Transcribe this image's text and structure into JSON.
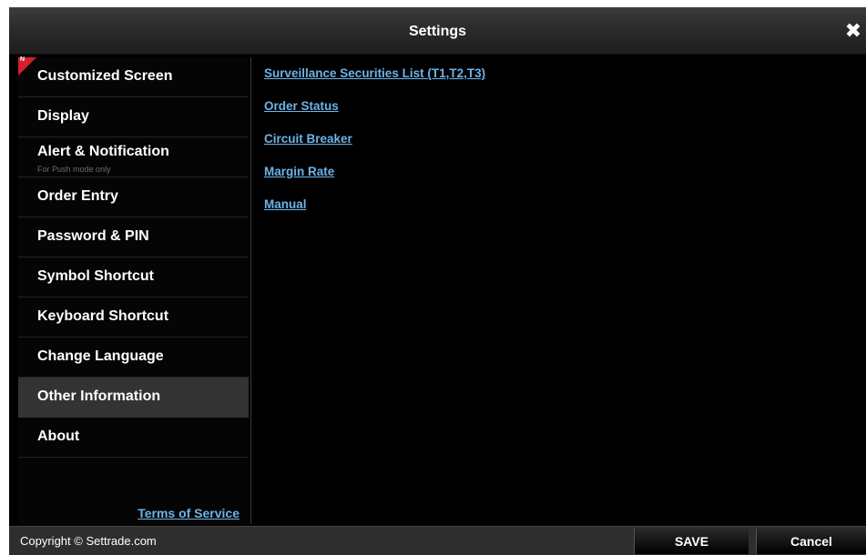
{
  "dialog": {
    "title": "Settings",
    "close_icon": "close-icon"
  },
  "sidebar": {
    "items": [
      {
        "label": "Customized Screen",
        "badge": "N"
      },
      {
        "label": "Display"
      },
      {
        "label": "Alert & Notification",
        "sublabel": "For Push mode only"
      },
      {
        "label": "Order Entry"
      },
      {
        "label": "Password & PIN"
      },
      {
        "label": "Symbol Shortcut"
      },
      {
        "label": "Keyboard Shortcut"
      },
      {
        "label": "Change Language"
      },
      {
        "label": "Other Information",
        "active": true
      },
      {
        "label": "About"
      }
    ],
    "terms_link": "Terms of Service"
  },
  "content": {
    "links": [
      "Surveillance Securities List (T1,T2,T3)",
      "Order Status",
      "Circuit Breaker",
      "Margin Rate",
      "Manual"
    ]
  },
  "footer": {
    "copyright": "Copyright © Settrade.com",
    "save_label": "SAVE",
    "cancel_label": "Cancel"
  },
  "colors": {
    "link": "#6db3e8",
    "badge": "#d2202e",
    "active_item_bg": "#333333",
    "background": "#000000"
  }
}
